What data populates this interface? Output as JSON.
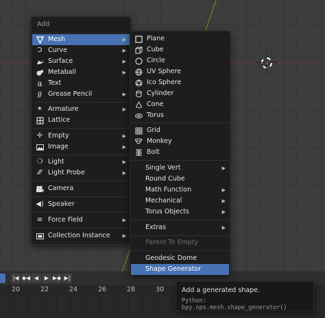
{
  "add_menu": {
    "title": "Add",
    "items": [
      {
        "label": "Mesh",
        "icon": "mesh-triangle-icon",
        "submenu": true,
        "selected": true
      },
      {
        "label": "Curve",
        "icon": "curve-icon",
        "submenu": true
      },
      {
        "label": "Surface",
        "icon": "surface-icon",
        "submenu": true
      },
      {
        "label": "Metaball",
        "icon": "metaball-icon",
        "submenu": true
      },
      {
        "label": "Text",
        "icon": "text-icon",
        "submenu": false
      },
      {
        "label": "Grease Pencil",
        "icon": "grease-pencil-icon",
        "submenu": true
      },
      {
        "label": "Armature",
        "icon": "armature-icon",
        "submenu": true
      },
      {
        "label": "Lattice",
        "icon": "lattice-icon",
        "submenu": false
      },
      {
        "label": "Empty",
        "icon": "empty-icon",
        "submenu": true
      },
      {
        "label": "Image",
        "icon": "image-icon",
        "submenu": true
      },
      {
        "label": "Light",
        "icon": "light-icon",
        "submenu": true
      },
      {
        "label": "Light Probe",
        "icon": "light-probe-icon",
        "submenu": true
      },
      {
        "label": "Camera",
        "icon": "camera-icon",
        "submenu": false
      },
      {
        "label": "Speaker",
        "icon": "speaker-icon",
        "submenu": false
      },
      {
        "label": "Force Field",
        "icon": "force-field-icon",
        "submenu": true
      },
      {
        "label": "Collection Instance",
        "icon": "collection-icon",
        "submenu": true
      }
    ]
  },
  "mesh_menu": {
    "items": [
      {
        "label": "Plane",
        "icon": "plane-icon"
      },
      {
        "label": "Cube",
        "icon": "cube-icon"
      },
      {
        "label": "Circle",
        "icon": "circle-icon"
      },
      {
        "label": "UV Sphere",
        "icon": "uv-sphere-icon"
      },
      {
        "label": "Ico Sphere",
        "icon": "ico-sphere-icon"
      },
      {
        "label": "Cylinder",
        "icon": "cylinder-icon"
      },
      {
        "label": "Cone",
        "icon": "cone-icon"
      },
      {
        "label": "Torus",
        "icon": "torus-icon"
      },
      {
        "label": "Grid",
        "icon": "grid-icon"
      },
      {
        "label": "Monkey",
        "icon": "monkey-icon"
      },
      {
        "label": "Bolt",
        "icon": "bolt-icon"
      },
      {
        "label": "Single Vert",
        "submenu": true
      },
      {
        "label": "Round Cube"
      },
      {
        "label": "Math Function",
        "submenu": true
      },
      {
        "label": "Mechanical",
        "submenu": true
      },
      {
        "label": "Torus Objects",
        "submenu": true
      },
      {
        "label": "Extras",
        "submenu": true
      },
      {
        "label": "Parent To Empty",
        "disabled": true
      },
      {
        "label": "Geodesic Dome"
      },
      {
        "label": "Shape Generator",
        "selected": true
      }
    ]
  },
  "timeline": {
    "frames": [
      "20",
      "22",
      "24",
      "26",
      "28",
      "30"
    ],
    "controls": [
      "jump-to-start-icon",
      "jump-to-keyframe-prev-icon",
      "play-reverse-icon",
      "play-icon",
      "jump-to-keyframe-next-icon",
      "jump-to-end-icon"
    ]
  },
  "tooltip": {
    "description": "Add a generated shape.",
    "python": "Python: bpy.ops.mesh.shape_generator()"
  },
  "colors": {
    "selection": "#4772b3",
    "menu_bg": "#1d1d1d",
    "viewport_bg": "#3d3d3d",
    "x_axis": "#7a3a3f",
    "y_axis": "#6d9b2c"
  }
}
